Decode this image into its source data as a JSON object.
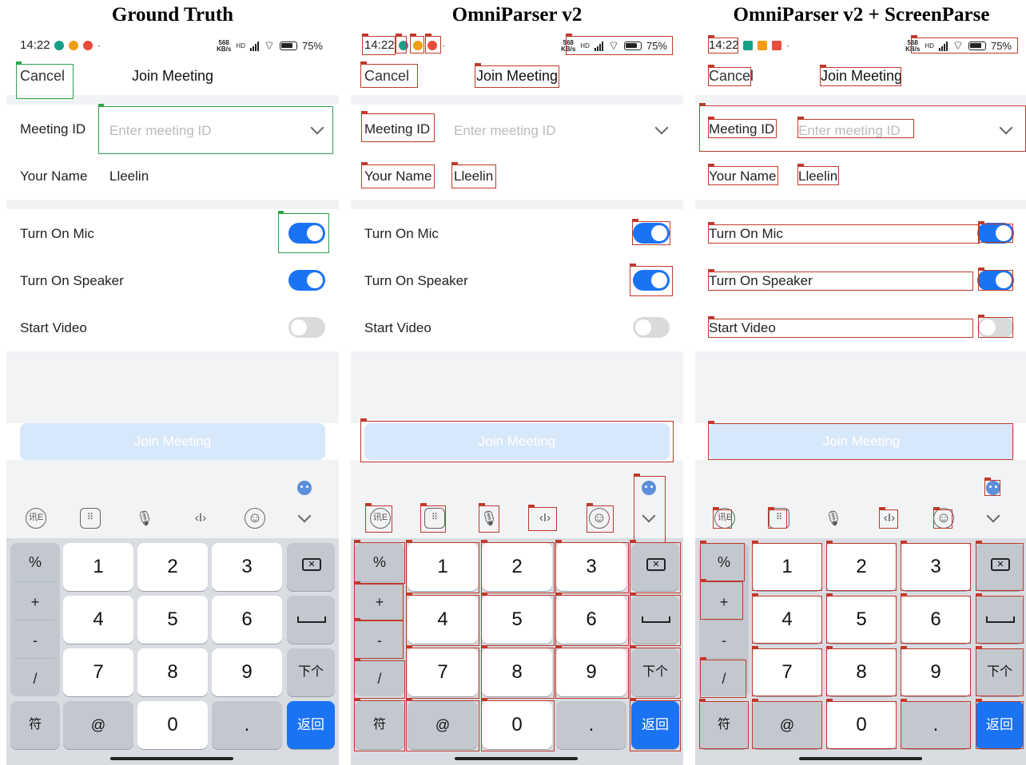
{
  "columns": [
    {
      "title": "Ground Truth"
    },
    {
      "title": "OmniParser v2"
    },
    {
      "title": "OmniParser v2 + ScreenParse"
    }
  ],
  "status": {
    "time": "14:22",
    "speed_top": "568",
    "speed_bottom": "KB/s",
    "network": "HD",
    "battery": "75%"
  },
  "header": {
    "cancel": "Cancel",
    "title": "Join Meeting"
  },
  "form": {
    "meeting_id_label": "Meeting ID",
    "meeting_id_placeholder": "Enter meeting ID",
    "your_name_label": "Your Name",
    "your_name_value": "Lleelin"
  },
  "toggles": [
    {
      "label": "Turn On Mic",
      "on": true
    },
    {
      "label": "Turn On Speaker",
      "on": true
    },
    {
      "label": "Start Video",
      "on": false
    }
  ],
  "join_button": "Join Meeting",
  "keyboard": {
    "toolbar_icons": [
      "handwriting-icon",
      "keyboard-icon",
      "microphone-icon",
      "cursor-icon",
      "emoji-icon",
      "chevron-down-icon"
    ],
    "toolbar_labels": {
      "handwriting": "讯E",
      "cursor": "‹I›",
      "emoji": "☺"
    },
    "symbols": [
      "%",
      "+",
      "-",
      "/"
    ],
    "digits_row1": [
      "1",
      "2",
      "3"
    ],
    "digits_row2": [
      "4",
      "5",
      "6"
    ],
    "digits_row3": [
      "7",
      "8",
      "9"
    ],
    "bottom": {
      "sym": "符",
      "at": "@",
      "zero": "0",
      "dot": ".",
      "return": "返回"
    },
    "next_key": "下个",
    "backspace_glyph": "✕"
  }
}
